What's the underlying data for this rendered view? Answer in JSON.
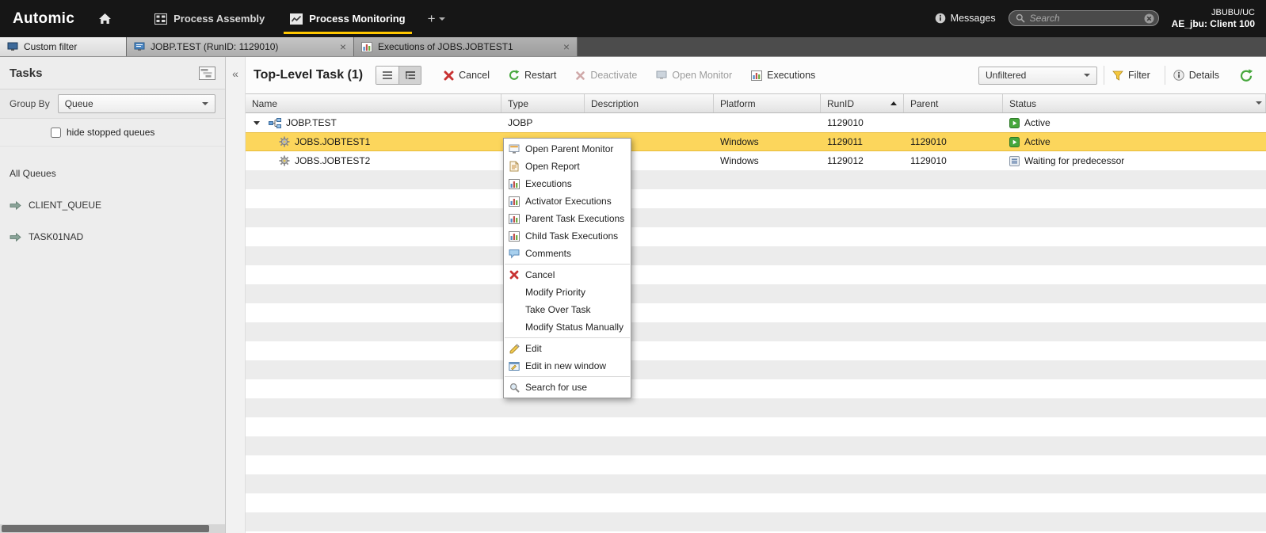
{
  "colors": {
    "brand_yellow": "#ffc700",
    "selection_yellow": "#fcd65c",
    "status_active_green": "#46a73c",
    "topbar_background": "#161616"
  },
  "icons": {
    "close": "×",
    "collapse": "«"
  },
  "topbar": {
    "brand": "Automic",
    "perspectives": [
      {
        "label": "Process Assembly"
      },
      {
        "label": "Process Monitoring"
      }
    ],
    "add_tab_label": "+",
    "messages_label": "Messages",
    "search_placeholder": "Search",
    "user_line1": "JBUBU/UC",
    "user_line2": "AE_jbu: Client 100"
  },
  "tabstrip": {
    "tabs": [
      {
        "label": "Custom filter",
        "closable": false
      },
      {
        "label": "JOBP.TEST (RunID: 1129010)",
        "closable": true
      },
      {
        "label": "Executions of JOBS.JOBTEST1",
        "closable": true
      }
    ]
  },
  "sidebar": {
    "title": "Tasks",
    "group_by_label": "Group By",
    "group_by_value": "Queue",
    "checkbox_label": "hide stopped queues",
    "checkbox_checked": false,
    "items": [
      {
        "label": "All Queues",
        "icon": ""
      },
      {
        "label": "CLIENT_QUEUE",
        "icon": "queue-icon"
      },
      {
        "label": "TASK01NAD",
        "icon": "queue-icon"
      }
    ]
  },
  "content": {
    "title": "Top-Level Task (1)",
    "toolbar": {
      "cancel": "Cancel",
      "restart": "Restart",
      "deactivate": "Deactivate",
      "open_monitor": "Open Monitor",
      "executions": "Executions"
    },
    "filter_select_value": "Unfiltered",
    "filter_button": "Filter",
    "details_button": "Details"
  },
  "table": {
    "columns": [
      "Name",
      "Type",
      "Description",
      "Platform",
      "RunID",
      "Parent",
      "Status"
    ],
    "sort": {
      "column": "RunID",
      "direction": "asc"
    },
    "rows": [
      {
        "name": "JOBP.TEST",
        "type": "JOBP",
        "description": "",
        "platform": "",
        "runid": "1129010",
        "parent": "",
        "status": "Active",
        "status_icon": "status-active-icon",
        "level": 0,
        "expanded": true,
        "selected": false,
        "row_icon": "workflow-icon"
      },
      {
        "name": "JOBS.JOBTEST1",
        "type": "",
        "description": "",
        "platform": "Windows",
        "runid": "1129011",
        "parent": "1129010",
        "status": "Active",
        "status_icon": "status-active-icon",
        "level": 1,
        "selected": true,
        "row_icon": "job-icon"
      },
      {
        "name": "JOBS.JOBTEST2",
        "type": "",
        "description": "",
        "platform": "Windows",
        "runid": "1129012",
        "parent": "1129010",
        "status": "Waiting for predecessor",
        "status_icon": "status-waiting-icon",
        "level": 1,
        "selected": false,
        "row_icon": "job-icon"
      }
    ]
  },
  "context_menu": {
    "groups": [
      {
        "items": [
          {
            "label": "Open Parent Monitor",
            "icon": "open-monitor-icon"
          },
          {
            "label": "Open Report",
            "icon": "report-icon"
          },
          {
            "label": "Executions",
            "icon": "executions-icon"
          },
          {
            "label": "Activator Executions",
            "icon": "executions-icon"
          },
          {
            "label": "Parent Task Executions",
            "icon": "executions-icon"
          },
          {
            "label": "Child Task Executions",
            "icon": "executions-icon"
          },
          {
            "label": "Comments",
            "icon": "comments-icon"
          }
        ]
      },
      {
        "items": [
          {
            "label": "Cancel",
            "icon": "cancel-icon"
          },
          {
            "label": "Modify Priority",
            "icon": ""
          },
          {
            "label": "Take Over Task",
            "icon": ""
          },
          {
            "label": "Modify Status Manually",
            "icon": ""
          }
        ]
      },
      {
        "items": [
          {
            "label": "Edit",
            "icon": "edit-icon"
          },
          {
            "label": "Edit in new window",
            "icon": "edit-new-window-icon"
          }
        ]
      },
      {
        "items": [
          {
            "label": "Search for use",
            "icon": "search-icon"
          }
        ]
      }
    ]
  }
}
